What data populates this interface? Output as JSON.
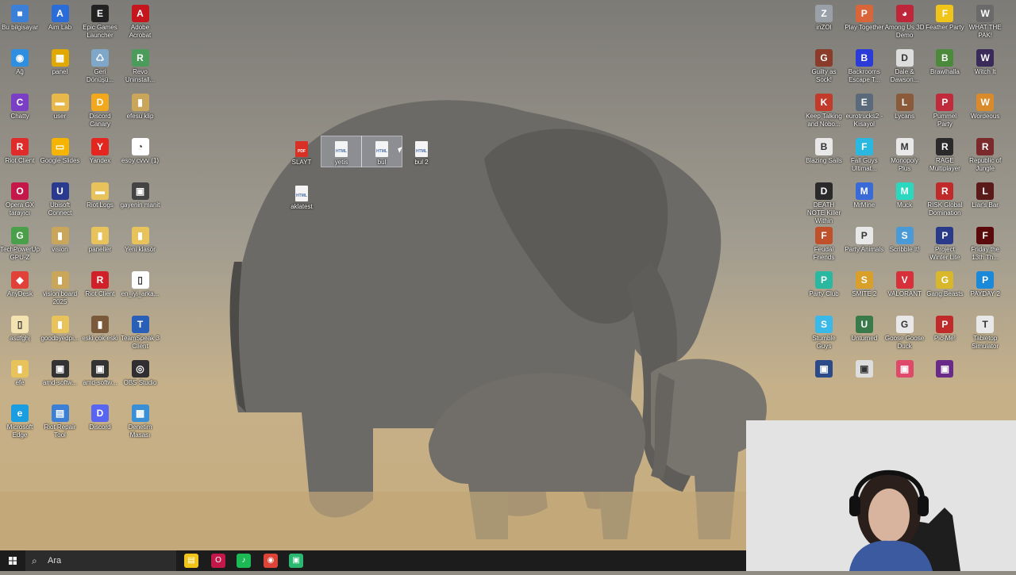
{
  "desktop": {
    "left_icons": [
      {
        "label": "Bu bilgisayar",
        "color": "#3b7fd6",
        "glyph": "■"
      },
      {
        "label": "Aim Lab",
        "color": "#2a6dd8",
        "glyph": "A"
      },
      {
        "label": "Epic Games Launcher",
        "color": "#222222",
        "glyph": "E"
      },
      {
        "label": "Adobe Acrobat",
        "color": "#c4161c",
        "glyph": "A"
      },
      {
        "label": "Ağ",
        "color": "#2f8ee0",
        "glyph": "◉"
      },
      {
        "label": "panel",
        "color": "#e0a800",
        "glyph": "▦"
      },
      {
        "label": "Geri Dönüşü...",
        "color": "#7fa7c9",
        "glyph": "♺"
      },
      {
        "label": "Revo Uninstall...",
        "color": "#4b9b5a",
        "glyph": "R"
      },
      {
        "label": "Chatty",
        "color": "#7a3fc4",
        "glyph": "C"
      },
      {
        "label": "user",
        "color": "#e8b84a",
        "glyph": "▬"
      },
      {
        "label": "Discord Canary",
        "color": "#f2a81d",
        "glyph": "D"
      },
      {
        "label": "efesu klip",
        "color": "#caa65b",
        "glyph": "▮"
      },
      {
        "label": "Riot Client",
        "color": "#e02b2b",
        "glyph": "R"
      },
      {
        "label": "Google Slides",
        "color": "#f4b400",
        "glyph": "▭"
      },
      {
        "label": "Yandex",
        "color": "#e52620",
        "glyph": "Y"
      },
      {
        "label": "esoy cvvv (1)",
        "color": "#ffffff",
        "glyph": "◔"
      },
      {
        "label": "Opera GX tarayıcı",
        "color": "#c4184a",
        "glyph": "O"
      },
      {
        "label": "Ubisoft Connect",
        "color": "#2a3b8f",
        "glyph": "U"
      },
      {
        "label": "Riot Logs",
        "color": "#e8c25a",
        "glyph": "▬"
      },
      {
        "label": "gayenin manit",
        "color": "#444444",
        "glyph": "▣"
      },
      {
        "label": "TechPowerUp GPU-Z",
        "color": "#4aa04a",
        "glyph": "G"
      },
      {
        "label": "vision",
        "color": "#caa65b",
        "glyph": "▮"
      },
      {
        "label": "paneller",
        "color": "#e8c25a",
        "glyph": "▮"
      },
      {
        "label": "Yeni klasör",
        "color": "#e8c25a",
        "glyph": "▮"
      },
      {
        "label": "AnyDesk",
        "color": "#e0423a",
        "glyph": "◆"
      },
      {
        "label": "vision board 2025",
        "color": "#caa65b",
        "glyph": "▮"
      },
      {
        "label": "Riot Client",
        "color": "#d0202a",
        "glyph": "R"
      },
      {
        "label": "en_iyi_arka...",
        "color": "#ffffff",
        "glyph": "▯"
      },
      {
        "label": "asdfghj",
        "color": "#f3e3b0",
        "glyph": "▯"
      },
      {
        "label": "goodbyedpi...",
        "color": "#e8c25a",
        "glyph": "▮"
      },
      {
        "label": "eski çok eski",
        "color": "#7a5a3a",
        "glyph": "▮"
      },
      {
        "label": "TeamSpeak 3 Client",
        "color": "#2a5fb8",
        "glyph": "T"
      },
      {
        "label": "efe",
        "color": "#e8c25a",
        "glyph": "▮"
      },
      {
        "label": "amd-softw...",
        "color": "#333333",
        "glyph": "▣"
      },
      {
        "label": "amd-softw...",
        "color": "#333333",
        "glyph": "▣"
      },
      {
        "label": "OBS Studio",
        "color": "#302e31",
        "glyph": "◎"
      },
      {
        "label": "Microsoft Edge",
        "color": "#1b9de2",
        "glyph": "e"
      },
      {
        "label": "Riot Repair Tool",
        "color": "#3b7fd6",
        "glyph": "▤"
      },
      {
        "label": "Discord",
        "color": "#5865f2",
        "glyph": "D"
      },
      {
        "label": "Denetim Masası",
        "color": "#3a8fd6",
        "glyph": "▦"
      }
    ],
    "middle_files": [
      {
        "label": "SLAYT",
        "type": "pdf"
      },
      {
        "label": "yetis",
        "type": "html",
        "selected": true
      },
      {
        "label": "bul",
        "type": "html",
        "selected": true
      },
      {
        "label": "bul 2",
        "type": "html"
      },
      {
        "label": "aklatest",
        "type": "html"
      }
    ],
    "right_icons": [
      {
        "label": "inZOI",
        "color": "#9aa0a8",
        "glyph": "Z"
      },
      {
        "label": "Play Together",
        "color": "#d9653b",
        "glyph": "P"
      },
      {
        "label": "Among Us 3D Demo",
        "color": "#c0263a",
        "glyph": "◕"
      },
      {
        "label": "Feather Party",
        "color": "#f0c419",
        "glyph": "F"
      },
      {
        "label": "WHAT THE PAK!",
        "color": "#6a6a6a",
        "glyph": "W"
      },
      {
        "label": "Guilty as Sock!",
        "color": "#8a3b2a",
        "glyph": "G"
      },
      {
        "label": "Backrooms Escape T...",
        "color": "#2a3bd8",
        "glyph": "B"
      },
      {
        "label": "Dale & Dawson...",
        "color": "#dddddd",
        "glyph": "D"
      },
      {
        "label": "Brawlhalla",
        "color": "#4a8a3a",
        "glyph": "B"
      },
      {
        "label": "Witch It",
        "color": "#3a2a5a",
        "glyph": "W"
      },
      {
        "label": "Keep Talking and Nobo...",
        "color": "#c23a2a",
        "glyph": "K"
      },
      {
        "label": "eurotrucks2 - Kısayol",
        "color": "#5a6a7a",
        "glyph": "E"
      },
      {
        "label": "Lycans",
        "color": "#8a5a3a",
        "glyph": "L"
      },
      {
        "label": "Pummel Party",
        "color": "#c02a3a",
        "glyph": "P"
      },
      {
        "label": "Wordeous",
        "color": "#d98a2a",
        "glyph": "W"
      },
      {
        "label": "Blazing Sails",
        "color": "#e8e8e8",
        "glyph": "B"
      },
      {
        "label": "Fall Guys Ultimat...",
        "color": "#2ab8e0",
        "glyph": "F"
      },
      {
        "label": "Monopoly Plus",
        "color": "#e8e8e8",
        "glyph": "M"
      },
      {
        "label": "RAGE Multiplayer",
        "color": "#2a2a2a",
        "glyph": "R"
      },
      {
        "label": "Republic of Jungle",
        "color": "#7a2a2a",
        "glyph": "R"
      },
      {
        "label": "DEATH NOTE Killer Within",
        "color": "#2a2a2a",
        "glyph": "D"
      },
      {
        "label": "MrMine",
        "color": "#3a6ad8",
        "glyph": "M"
      },
      {
        "label": "Muck",
        "color": "#2ad8c0",
        "glyph": "M"
      },
      {
        "label": "RISK Global Domination",
        "color": "#c02a2a",
        "glyph": "R"
      },
      {
        "label": "Liar's Bar",
        "color": "#5a1a1a",
        "glyph": "L"
      },
      {
        "label": "Feudal Friends",
        "color": "#c0502a",
        "glyph": "F"
      },
      {
        "label": "Party Animals",
        "color": "#e8e8e8",
        "glyph": "P"
      },
      {
        "label": "Scribble It!",
        "color": "#4a9ad8",
        "glyph": "S"
      },
      {
        "label": "Project Winter Lite",
        "color": "#2a3a8a",
        "glyph": "P"
      },
      {
        "label": "Friday the 13th Th...",
        "color": "#5a0a0a",
        "glyph": "F"
      },
      {
        "label": "Party Club",
        "color": "#2ab8a0",
        "glyph": "P"
      },
      {
        "label": "SMITE 2",
        "color": "#d8a02a",
        "glyph": "S"
      },
      {
        "label": "VALORANT",
        "color": "#d8303a",
        "glyph": "V"
      },
      {
        "label": "Gang Beasts",
        "color": "#d8b82a",
        "glyph": "G"
      },
      {
        "label": "PAYDAY 2",
        "color": "#1a8ad8",
        "glyph": "P"
      },
      {
        "label": "Stumble Guys",
        "color": "#3ab8e8",
        "glyph": "S"
      },
      {
        "label": "Unturned",
        "color": "#3a7a4a",
        "glyph": "U"
      },
      {
        "label": "Goose Goose Duck",
        "color": "#e8e8e8",
        "glyph": "G"
      },
      {
        "label": "Pic-Me!",
        "color": "#c02a2a",
        "glyph": "P"
      },
      {
        "label": "Tabletop Simulator",
        "color": "#e8e8e8",
        "glyph": "T"
      },
      {
        "label": "",
        "color": "#2a4a8a",
        "glyph": "▣"
      },
      {
        "label": "",
        "color": "#dddddd",
        "glyph": "▣"
      },
      {
        "label": "",
        "color": "#e04a6a",
        "glyph": "▣"
      },
      {
        "label": "",
        "color": "#6a2a8a",
        "glyph": "▣"
      }
    ]
  },
  "taskbar": {
    "search_placeholder": "Ara",
    "apps": [
      {
        "name": "file-explorer",
        "color": "#f0c419",
        "glyph": "▤"
      },
      {
        "name": "opera-gx",
        "color": "#c4184a",
        "glyph": "O"
      },
      {
        "name": "spotify",
        "color": "#1db954",
        "glyph": "♪"
      },
      {
        "name": "chrome",
        "color": "#db4437",
        "glyph": "◉"
      },
      {
        "name": "green-app",
        "color": "#2ab870",
        "glyph": "▣"
      }
    ]
  }
}
